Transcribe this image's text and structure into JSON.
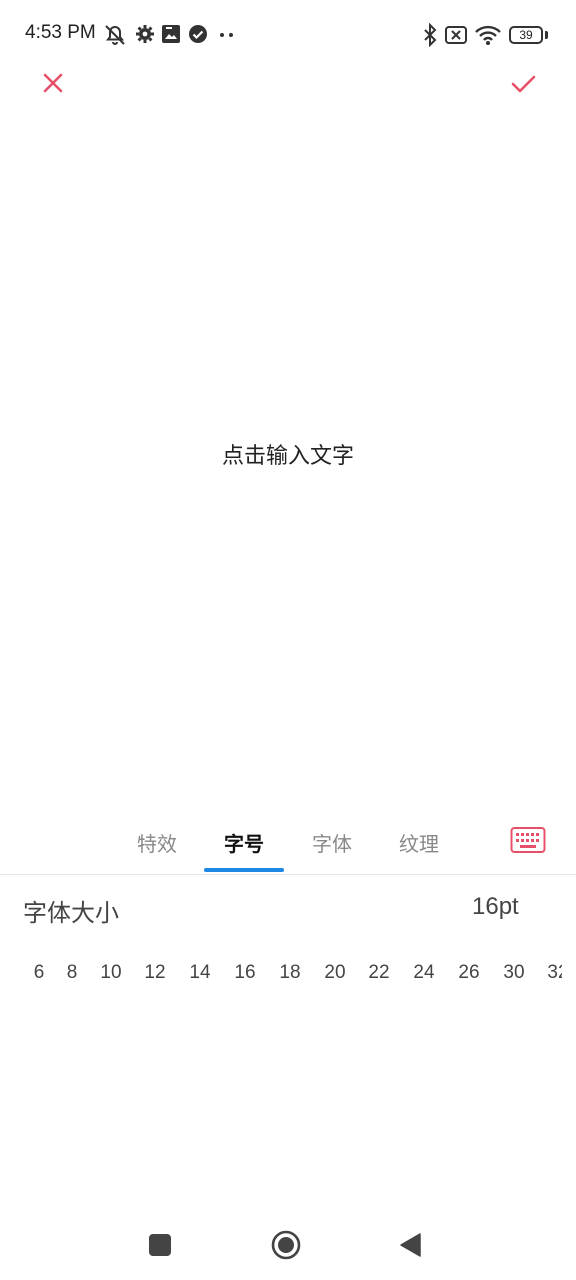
{
  "status": {
    "time": "4:53 PM",
    "battery": "39"
  },
  "canvas": {
    "placeholder": "点击输入文字"
  },
  "tabs": [
    {
      "label": "特效"
    },
    {
      "label": "字号"
    },
    {
      "label": "字体"
    },
    {
      "label": "纹理"
    }
  ],
  "font_size": {
    "label": "字体大小",
    "value": "16pt",
    "options": [
      "6",
      "8",
      "10",
      "12",
      "14",
      "16",
      "18",
      "20",
      "22",
      "24",
      "26",
      "30",
      "32"
    ]
  },
  "colors": {
    "accent_red": "#e8506a",
    "tab_indicator": "#1e88e5"
  }
}
